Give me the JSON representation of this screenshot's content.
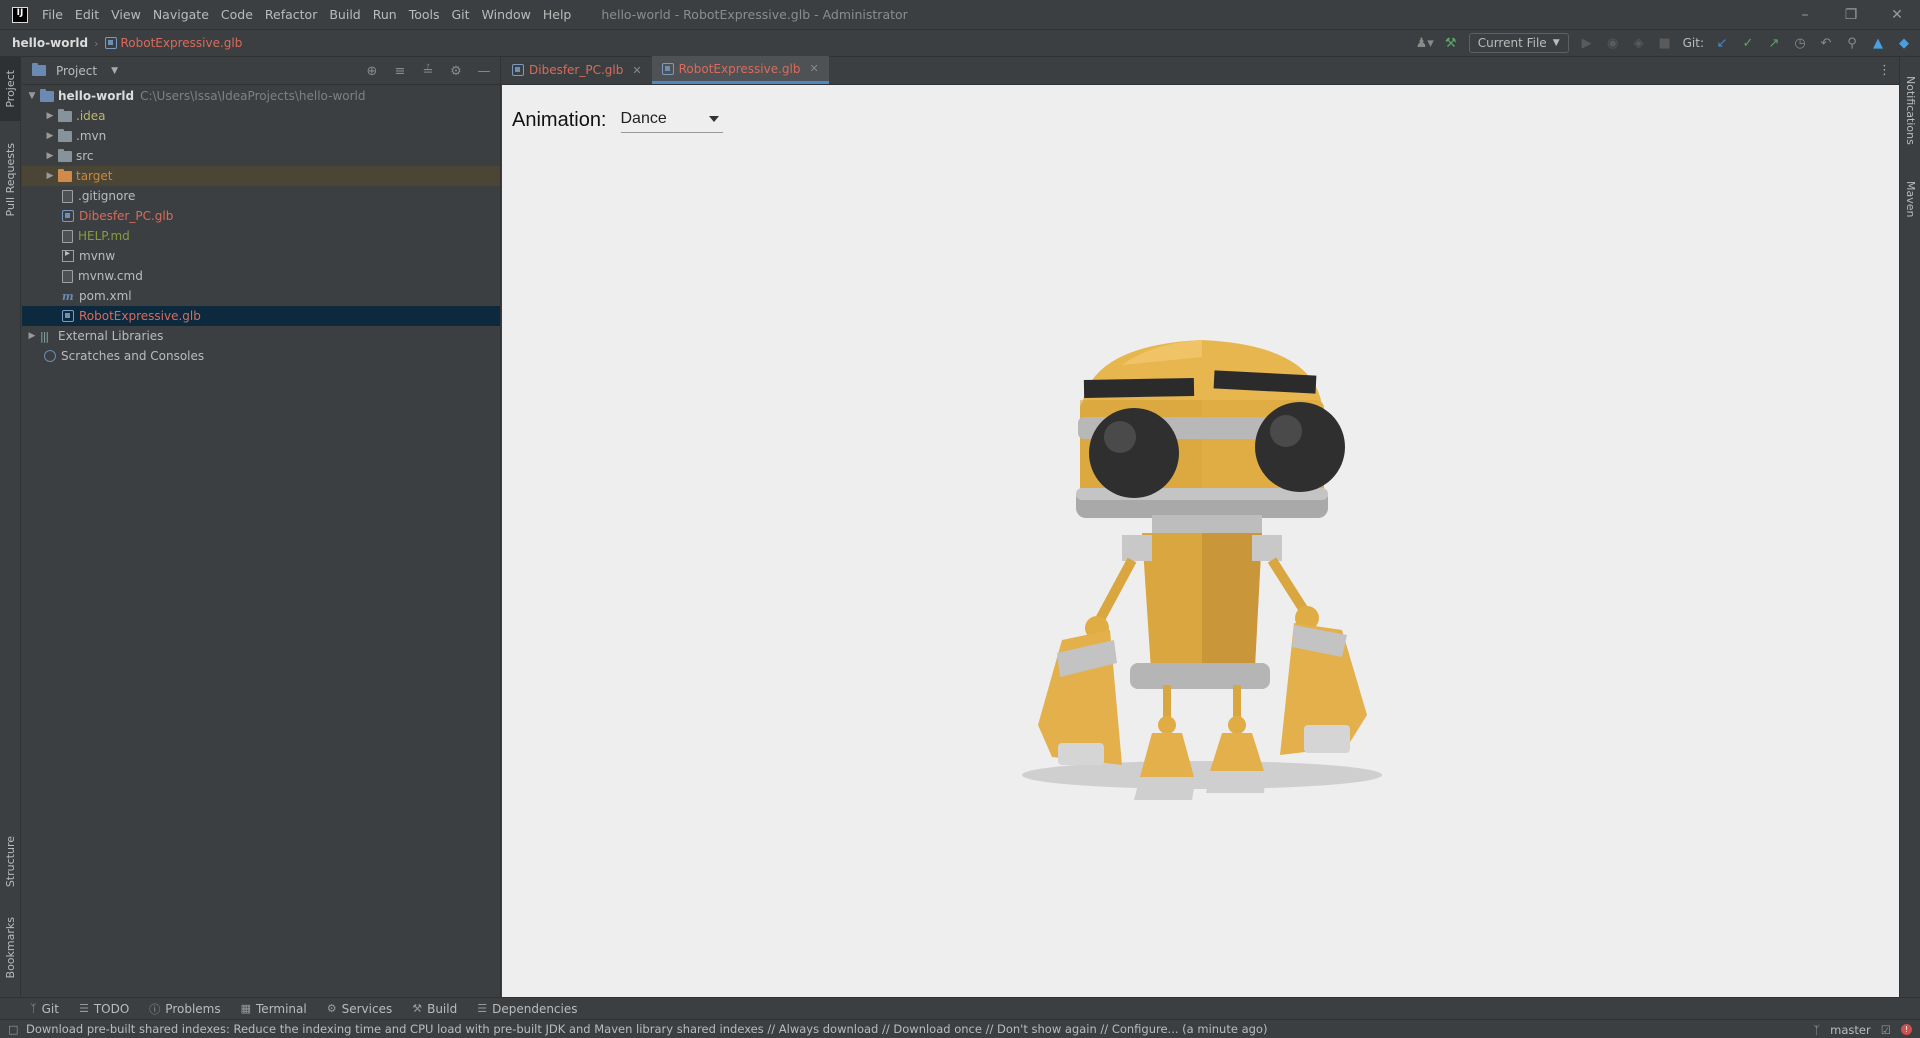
{
  "app": {
    "logo_text": "IJ",
    "menu": [
      "File",
      "Edit",
      "View",
      "Navigate",
      "Code",
      "Refactor",
      "Build",
      "Run",
      "Tools",
      "Git",
      "Window",
      "Help"
    ],
    "window_title": "hello-world - RobotExpressive.glb - Administrator"
  },
  "navbar": {
    "project": "hello-world",
    "file": "RobotExpressive.glb",
    "run_config": "Current File",
    "git_label": "Git:"
  },
  "left_stripe": {
    "project": "Project",
    "pull_requests": "Pull Requests",
    "structure": "Structure",
    "bookmarks": "Bookmarks"
  },
  "right_stripe": {
    "notifications": "Notifications",
    "maven": "Maven"
  },
  "project_panel": {
    "title": "Project",
    "root": {
      "name": "hello-world",
      "path": "C:\\Users\\Issa\\IdeaProjects\\hello-world"
    },
    "items": [
      {
        "name": ".idea"
      },
      {
        "name": ".mvn"
      },
      {
        "name": "src"
      },
      {
        "name": "target"
      },
      {
        "name": ".gitignore"
      },
      {
        "name": "Dibesfer_PC.glb"
      },
      {
        "name": "HELP.md"
      },
      {
        "name": "mvnw"
      },
      {
        "name": "mvnw.cmd"
      },
      {
        "name": "pom.xml"
      },
      {
        "name": "RobotExpressive.glb"
      }
    ],
    "external_libraries": "External Libraries",
    "scratches": "Scratches and Consoles"
  },
  "editor": {
    "tabs": [
      {
        "label": "Dibesfer_PC.glb",
        "active": false
      },
      {
        "label": "RobotExpressive.glb",
        "active": true
      }
    ],
    "animation_label": "Animation:",
    "animation_value": "Dance"
  },
  "bottom_tools": [
    "Git",
    "TODO",
    "Problems",
    "Terminal",
    "Services",
    "Build",
    "Dependencies"
  ],
  "status": {
    "message": "Download pre-built shared indexes: Reduce the indexing time and CPU load with pre-built JDK and Maven library shared indexes // Always download // Download once // Don't show again // Configure... (a minute ago)",
    "branch": "master"
  },
  "colors": {
    "accent": "#4a88c7",
    "robot_body": "#e3b04b",
    "modified_file": "#d96b5b"
  }
}
